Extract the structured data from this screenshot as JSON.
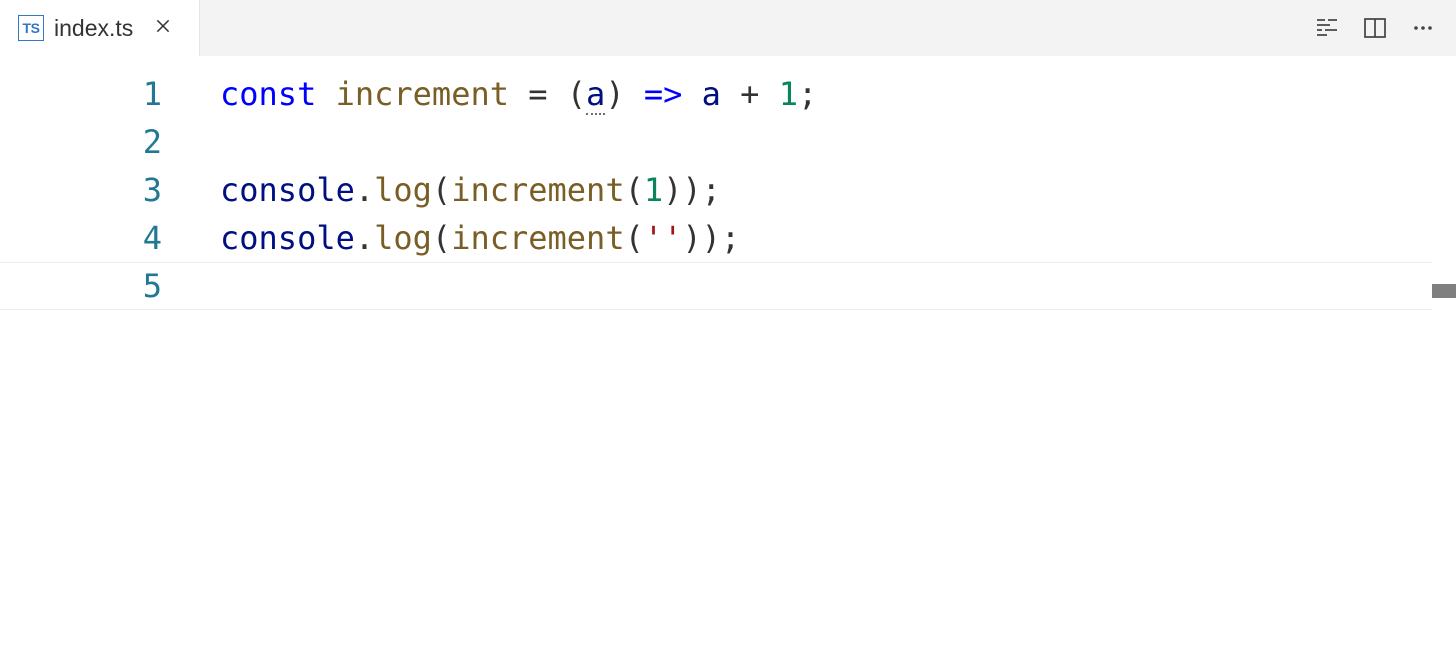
{
  "tab": {
    "icon_text": "TS",
    "filename": "index.ts"
  },
  "editor": {
    "lines": {
      "l1": {
        "num": "1",
        "kw_const": "const",
        "sp1": " ",
        "fname": "increment",
        "sp2": " ",
        "eq": "=",
        "sp3": " ",
        "lparen": "(",
        "param": "a",
        "rparen": ")",
        "sp4": " ",
        "arrow": "=>",
        "sp5": " ",
        "bodyvar": "a",
        "sp6": " ",
        "plus": "+",
        "sp7": " ",
        "one": "1",
        "semi": ";"
      },
      "l2": {
        "num": "2"
      },
      "l3": {
        "num": "3",
        "obj": "console",
        "dot": ".",
        "method": "log",
        "lparen": "(",
        "callfn": "increment",
        "lparen2": "(",
        "arg": "1",
        "rparen2": ")",
        "rparen": ")",
        "semi": ";"
      },
      "l4": {
        "num": "4",
        "obj": "console",
        "dot": ".",
        "method": "log",
        "lparen": "(",
        "callfn": "increment",
        "lparen2": "(",
        "arg": "''",
        "rparen2": ")",
        "rparen": ")",
        "semi": ";"
      },
      "l5": {
        "num": "5"
      }
    }
  }
}
